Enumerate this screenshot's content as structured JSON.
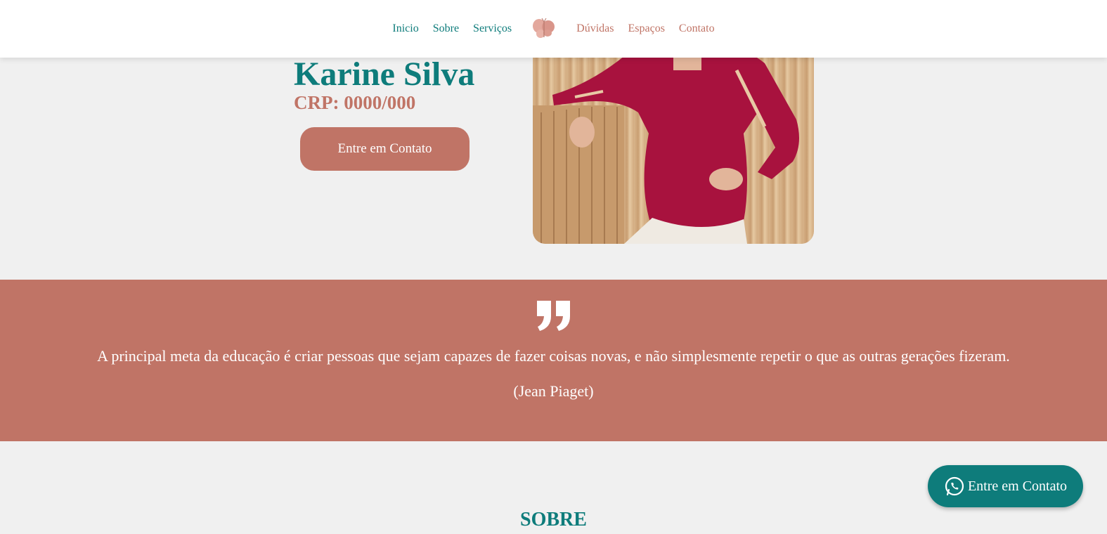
{
  "nav": {
    "left": [
      "Inicio",
      "Sobre",
      "Serviços"
    ],
    "right": [
      "Dúvidas",
      "Espaços",
      "Contato"
    ]
  },
  "hero": {
    "name": "Karine Silva",
    "crp": "CRP: 0000/000",
    "cta_label": "Entre em Contato"
  },
  "quote": {
    "text": "A principal meta da educação é criar pessoas que sejam capazes de fazer coisas novas, e não simplesmente repetir o que as outras gerações fizeram.",
    "author": "(Jean Piaget)"
  },
  "sobre": {
    "title": "SOBRE"
  },
  "whatsapp": {
    "label": "Entre em Contato",
    "icon": "whatsapp-icon"
  },
  "colors": {
    "teal": "#0e7c7b",
    "terracotta": "#c07466",
    "background": "#f0f0f0"
  }
}
